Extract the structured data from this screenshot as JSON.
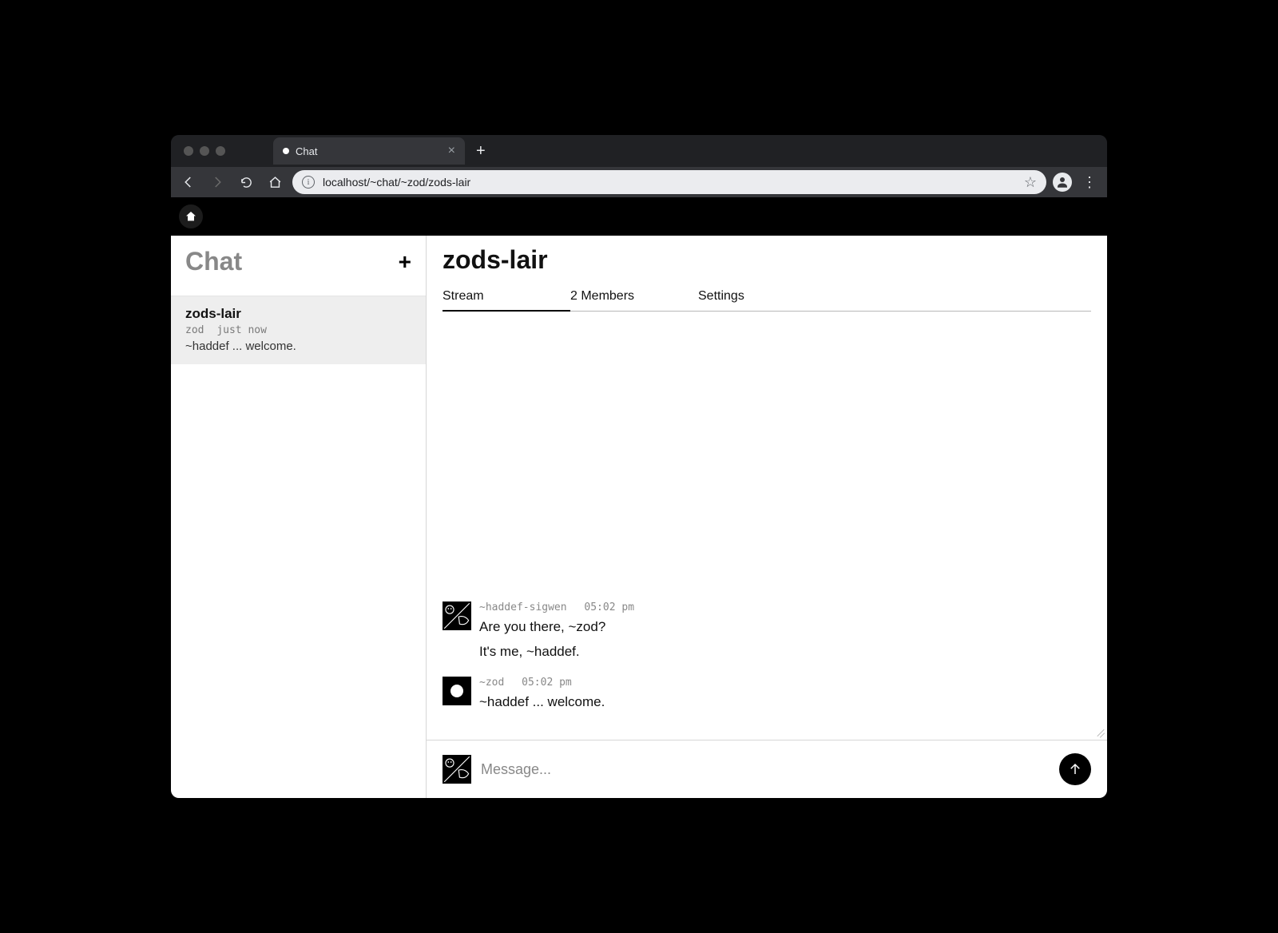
{
  "browser": {
    "tab_title": "Chat",
    "url": "localhost/~chat/~zod/zods-lair"
  },
  "sidebar": {
    "title": "Chat",
    "items": [
      {
        "name": "zods-lair",
        "author": "zod",
        "time": "just now",
        "preview": "~haddef ... welcome."
      }
    ]
  },
  "main": {
    "title": "zods-lair",
    "tabs": [
      {
        "label": "Stream",
        "active": true
      },
      {
        "label": "2 Members",
        "active": false
      },
      {
        "label": "Settings",
        "active": false
      }
    ],
    "messages": [
      {
        "author": "~haddef-sigwen",
        "time": "05:02 pm",
        "avatar": "sigil",
        "lines": [
          "Are you there, ~zod?",
          "It's me, ~haddef."
        ]
      },
      {
        "author": "~zod",
        "time": "05:02 pm",
        "avatar": "zod",
        "lines": [
          "~haddef ... welcome."
        ]
      }
    ],
    "composer": {
      "placeholder": "Message..."
    }
  }
}
